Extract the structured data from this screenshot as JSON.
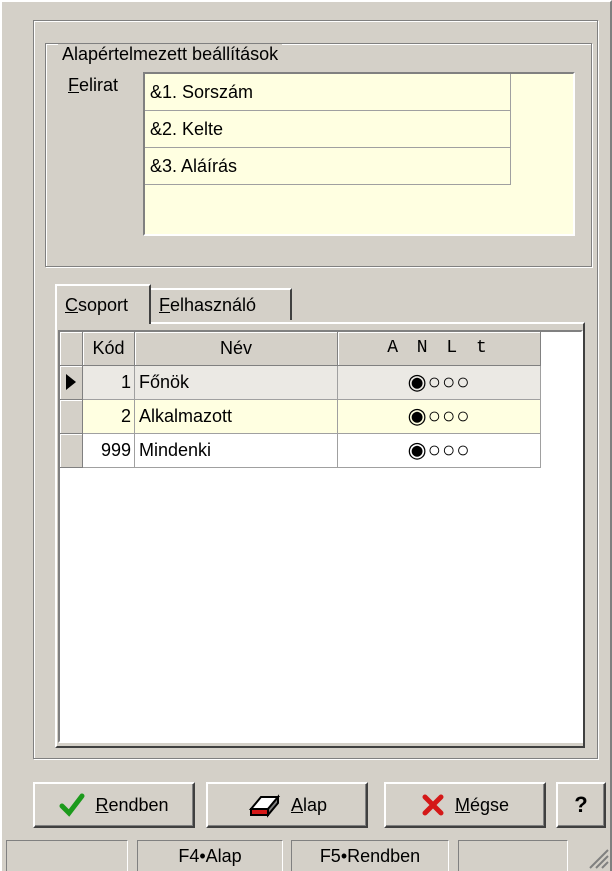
{
  "defaults": {
    "legend": "Alapértelmezett beállítások",
    "caption_label_key": "F",
    "caption_label_rest": "elirat",
    "captions": [
      "&1. Sorszám",
      "&2. Kelte",
      "&3. Aláírás"
    ]
  },
  "tabs": [
    {
      "key": "C",
      "rest": "soport",
      "active": true
    },
    {
      "key": "F",
      "rest": "elhasználó",
      "active": false
    }
  ],
  "grid": {
    "columns": [
      "Kód",
      "Név",
      "A N L t"
    ],
    "rows": [
      {
        "code": "1",
        "name": "Főnök",
        "rights": "◉○○○",
        "current": true
      },
      {
        "code": "2",
        "name": "Alkalmazott",
        "rights": "◉○○○",
        "current": false
      },
      {
        "code": "999",
        "name": "Mindenki",
        "rights": "◉○○○",
        "current": false
      }
    ]
  },
  "buttons": {
    "ok": {
      "key": "R",
      "rest": "endben",
      "icon": "check-icon"
    },
    "default": {
      "key": "A",
      "rest": "lap",
      "icon": "eraser-icon"
    },
    "cancel": {
      "key": "M",
      "rest": "égse",
      "icon": "x-icon"
    },
    "help": "?"
  },
  "status": [
    "F4•Alap",
    "F5•Rendben"
  ],
  "colors": {
    "face": "#d4d0c8",
    "info": "#ffffe1",
    "ok": "#1c9a1c",
    "cancel": "#d41818"
  }
}
